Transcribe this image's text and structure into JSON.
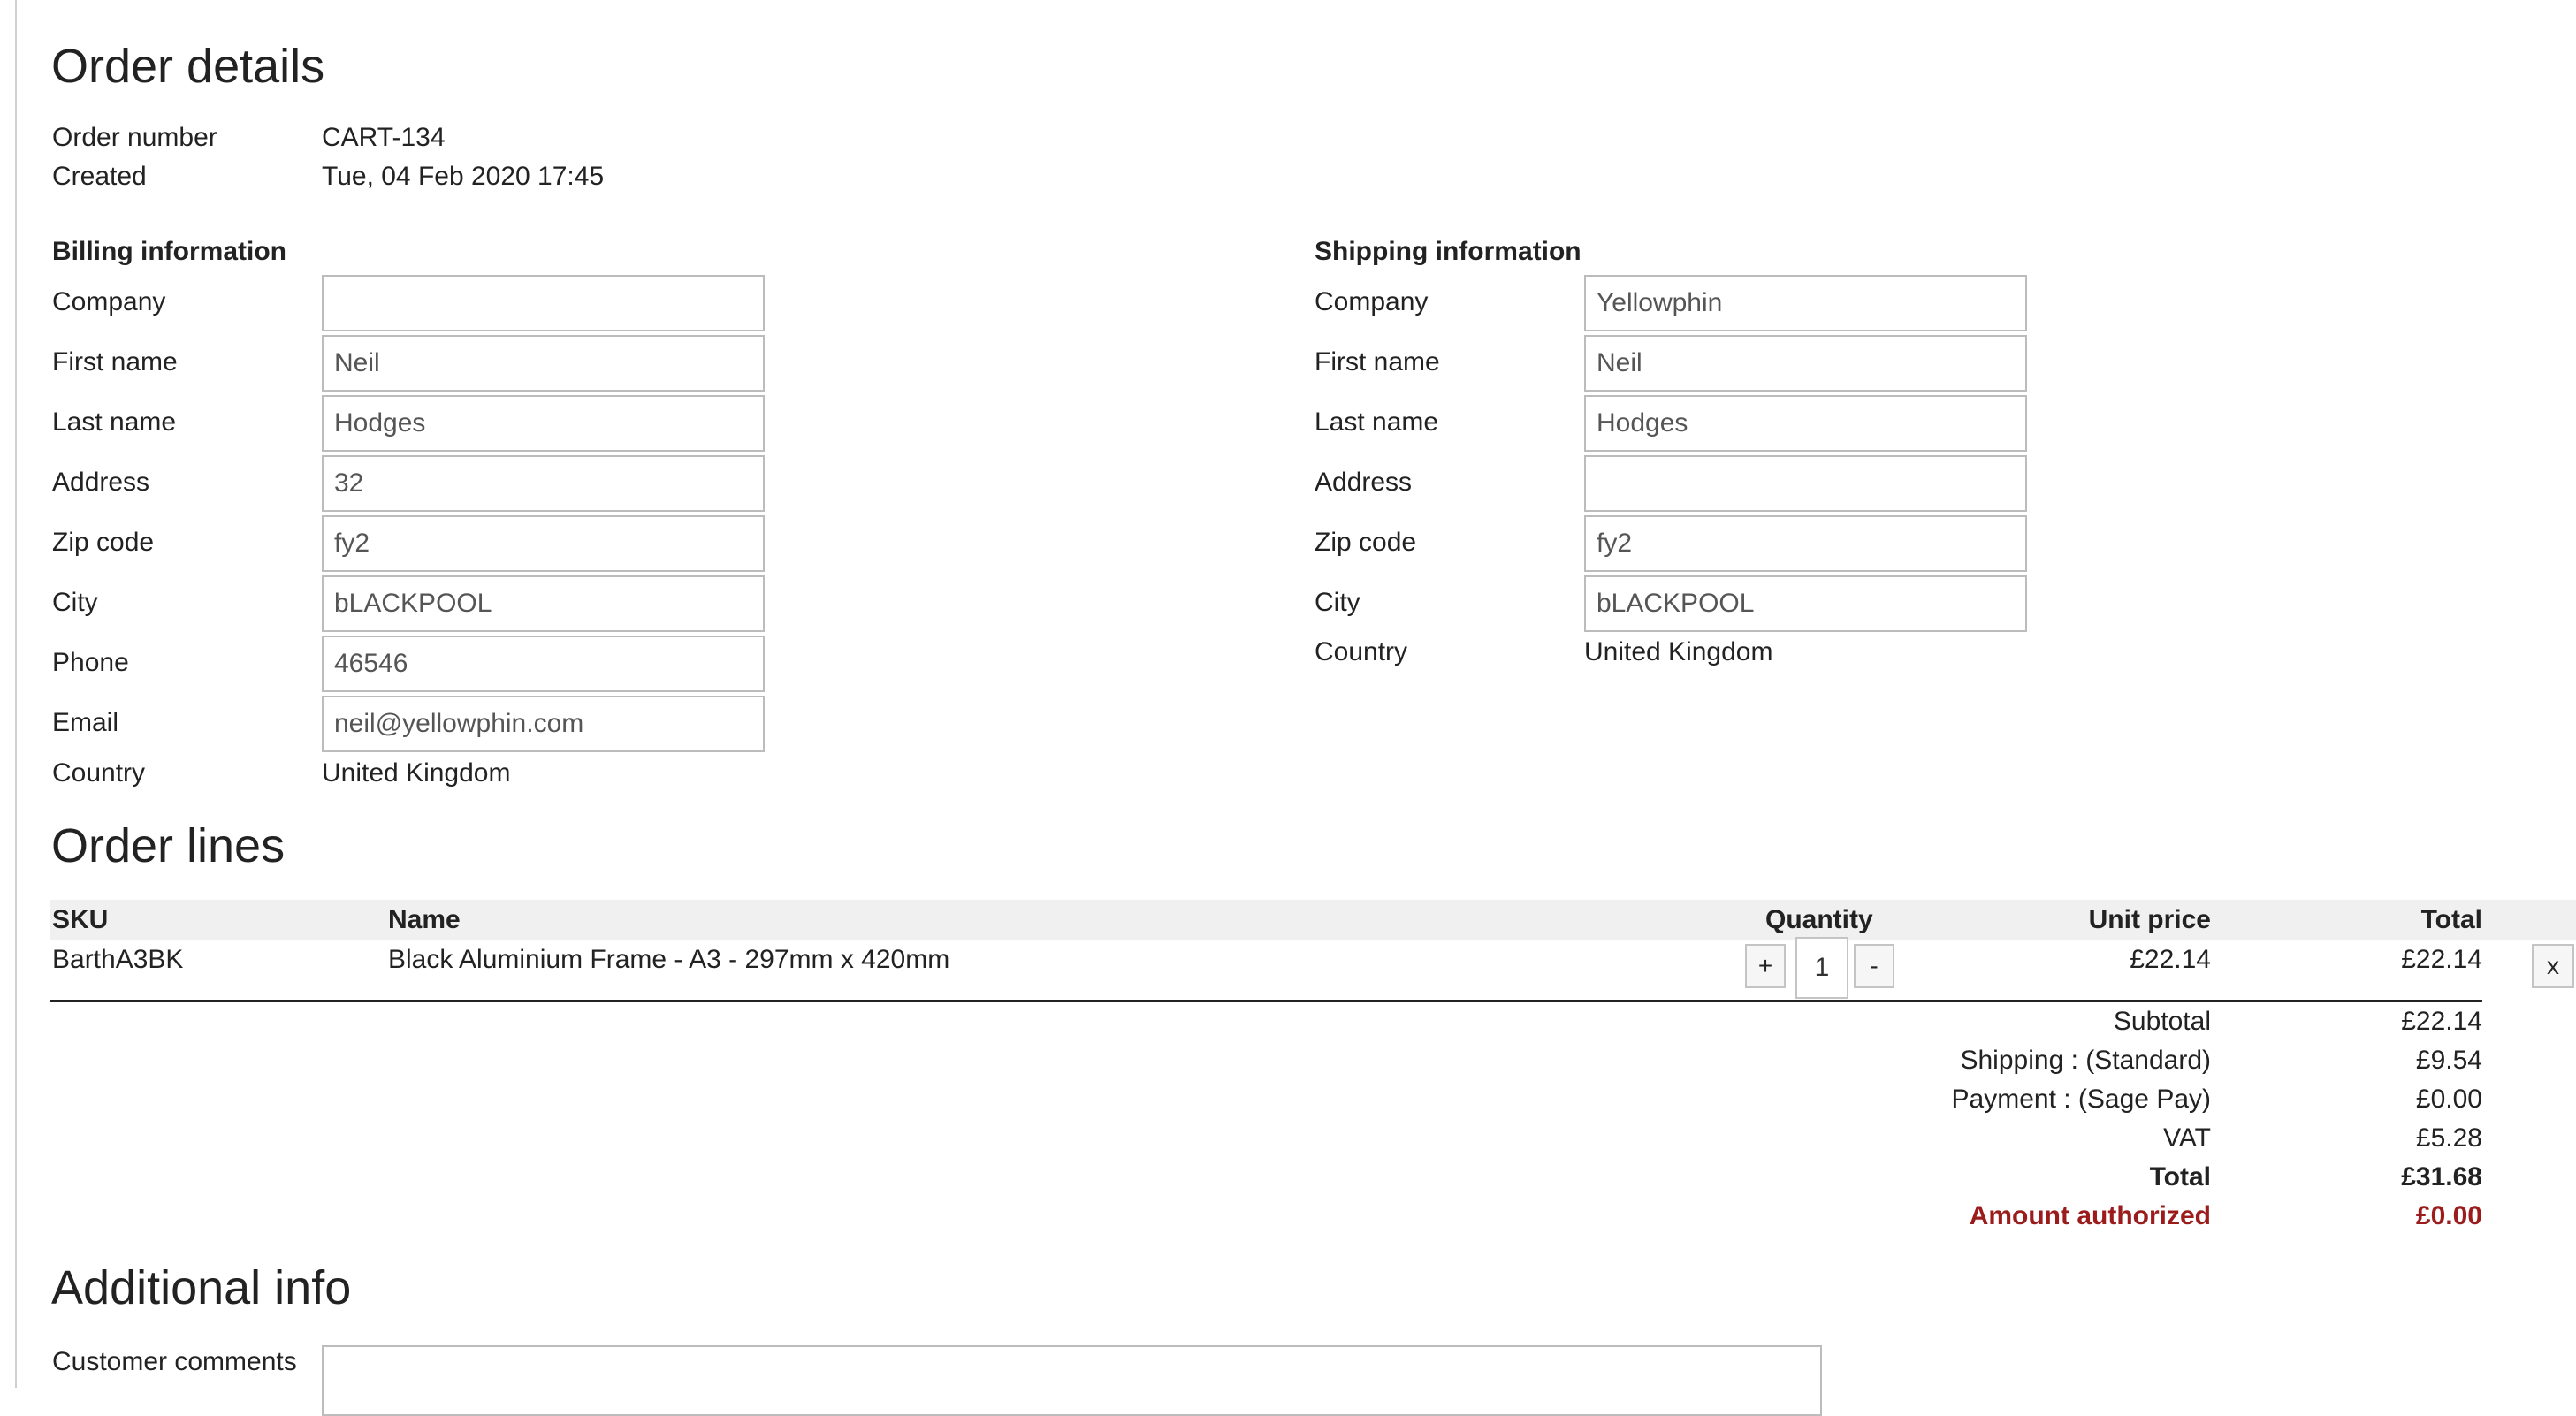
{
  "order_details": {
    "title": "Order details",
    "order_number_label": "Order number",
    "order_number": "CART-134",
    "created_label": "Created",
    "created": "Tue, 04 Feb 2020 17:45"
  },
  "billing": {
    "title": "Billing information",
    "company_label": "Company",
    "company": "",
    "first_name_label": "First name",
    "first_name": "Neil",
    "last_name_label": "Last name",
    "last_name": "Hodges",
    "address_label": "Address",
    "address": "32",
    "zip_label": "Zip code",
    "zip": "fy2",
    "city_label": "City",
    "city": "bLACKPOOL",
    "phone_label": "Phone",
    "phone": "46546",
    "email_label": "Email",
    "email": "neil@yellowphin.com",
    "country_label": "Country",
    "country": "United Kingdom"
  },
  "shipping": {
    "title": "Shipping information",
    "company_label": "Company",
    "company": "Yellowphin",
    "first_name_label": "First name",
    "first_name": "Neil",
    "last_name_label": "Last name",
    "last_name": "Hodges",
    "address_label": "Address",
    "address": "",
    "zip_label": "Zip code",
    "zip": "fy2",
    "city_label": "City",
    "city": "bLACKPOOL",
    "country_label": "Country",
    "country": "United Kingdom"
  },
  "order_lines": {
    "title": "Order lines",
    "columns": {
      "sku": "SKU",
      "name": "Name",
      "quantity": "Quantity",
      "unit_price": "Unit price",
      "total": "Total"
    },
    "rows": [
      {
        "sku": "BarthA3BK",
        "name": "Black Aluminium Frame - A3 - 297mm x 420mm",
        "quantity": "1",
        "unit_price": "£22.14",
        "total": "£22.14",
        "plus_label": "+",
        "minus_label": "-",
        "remove_label": "x"
      }
    ],
    "summary": {
      "subtotal_label": "Subtotal",
      "subtotal": "£22.14",
      "shipping_label": "Shipping : (Standard)",
      "shipping": "£9.54",
      "payment_label": "Payment : (Sage Pay)",
      "payment": "£0.00",
      "vat_label": "VAT",
      "vat": "£5.28",
      "total_label": "Total",
      "total": "£31.68",
      "authorized_label": "Amount authorized",
      "authorized": "£0.00",
      "authorized_color": "#9b1c1c"
    }
  },
  "additional_info": {
    "title": "Additional info",
    "comments_label": "Customer comments",
    "comments": ""
  }
}
